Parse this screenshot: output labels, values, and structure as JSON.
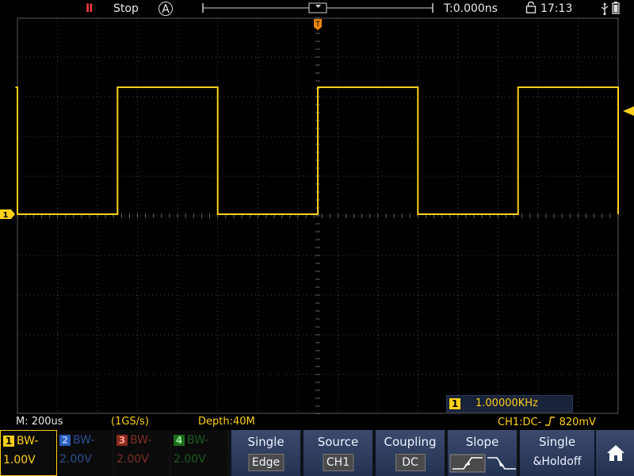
{
  "status_bar": {
    "run_icon": "II",
    "run_state": "Stop",
    "trigger_mode_icon": "A",
    "time_offset": "T:0.000ns",
    "clock": "17:13",
    "icons": [
      "pause-icon",
      "auto-trigger-icon",
      "trigger-position-marker-icon",
      "lock-icon",
      "usb-icon",
      "battery-icon"
    ]
  },
  "markers": {
    "trigger_pos_label": "T",
    "ch1_ground_label": "1"
  },
  "readouts": {
    "timebase": "M: 200us",
    "sample_rate": "(1GS/s)",
    "depth": "Depth:40M",
    "trigger": "CH1:DC-",
    "trigger_level": "820mV",
    "freq_channel": "1",
    "frequency": "1.00000KHz"
  },
  "channels": [
    {
      "badge": "1",
      "bw": "BW-",
      "scale": "1.00V",
      "color": "#ffcf1a",
      "active": true
    },
    {
      "badge": "2",
      "bw": "BW-",
      "scale": "2.00V",
      "color": "#2a5dbb",
      "active": false
    },
    {
      "badge": "3",
      "bw": "BW-",
      "scale": "2.00V",
      "color": "#8a2a1e",
      "active": false
    },
    {
      "badge": "4",
      "bw": "BW-",
      "scale": "2.00V",
      "color": "#1e6a1e",
      "active": false
    }
  ],
  "softkeys": {
    "type": {
      "title": "Single",
      "value": "Edge"
    },
    "source": {
      "title": "Source",
      "value": "CH1"
    },
    "coupling": {
      "title": "Coupling",
      "value": "DC"
    },
    "slope": {
      "title": "Slope",
      "options": [
        "rising-edge-icon",
        "falling-edge-icon"
      ],
      "selected": "rising-edge-icon"
    },
    "mode": {
      "title": "Single",
      "value": "&Holdoff"
    },
    "home_icon": "home-icon"
  },
  "colors": {
    "ch1": "#ffcf1a",
    "grid": "#5a5a5a",
    "menu": "#2c3b5e"
  },
  "chart_data": {
    "type": "line",
    "divisions": {
      "x": 15,
      "y": 10
    },
    "time_per_div_us": 200,
    "volts_per_div": 1.0,
    "series": [
      {
        "x_us": [
          -1510,
          -1500,
          -1500,
          -1000,
          -1000,
          -500,
          -500,
          0,
          0,
          500,
          500,
          1000,
          1000,
          1500,
          1500
        ],
        "y_div": [
          3.2,
          3.2,
          0,
          0,
          3.2,
          3.2,
          0,
          0,
          3.2,
          3.2,
          0,
          0,
          3.2,
          3.2,
          0
        ]
      }
    ],
    "trigger_level_div": 2.6
  }
}
